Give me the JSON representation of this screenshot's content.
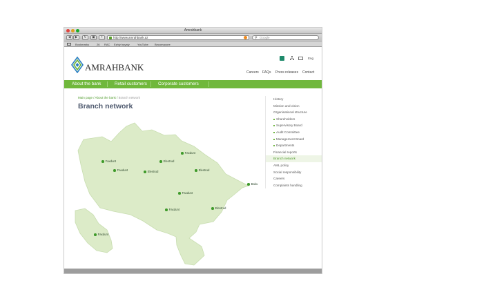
{
  "window": {
    "title": "Amrahbank"
  },
  "toolbar": {
    "url": "http://www.amrahbank.az",
    "search_placeholder": "Google",
    "back_icon": "back-arrow-icon",
    "forward_icon": "forward-arrow-icon",
    "reload_icon": "reload-icon",
    "add_icon": "plus-icon"
  },
  "bookmarks": [
    "Bookmarks",
    "26",
    "RAC",
    "Ezhiy hayaty",
    "YouTube",
    "Becomaoore"
  ],
  "site": {
    "brand": "AMRAHBANK",
    "lang": "Eng",
    "top_links": [
      "Careers",
      "FAQs",
      "Press releases",
      "Contact"
    ],
    "nav": [
      "About the bank",
      "Retail customers",
      "Corporate customers"
    ],
    "breadcrumb": {
      "home": "Main page",
      "parent": "About the bank",
      "current": "Branch network"
    },
    "page_title": "Branch network",
    "map_pins": [
      {
        "label": "Faxdunt"
      },
      {
        "label": "Faxdunt"
      },
      {
        "label": "Elestrud"
      },
      {
        "label": "Faxdunt"
      },
      {
        "label": "Elestrud"
      },
      {
        "label": "Elestrud"
      },
      {
        "label": "Baku"
      },
      {
        "label": "Faxdunt"
      },
      {
        "label": "Faxdunt"
      },
      {
        "label": "Elestrud"
      },
      {
        "label": "Faxdunt"
      }
    ],
    "sidebar": [
      {
        "label": "History",
        "sub": false,
        "active": false
      },
      {
        "label": "Mission and vision",
        "sub": false,
        "active": false
      },
      {
        "label": "Organisational structure",
        "sub": false,
        "active": false
      },
      {
        "label": "Shareholders",
        "sub": true,
        "active": false
      },
      {
        "label": "Supervisory Board",
        "sub": true,
        "active": false
      },
      {
        "label": "Audit Committee",
        "sub": true,
        "active": false
      },
      {
        "label": "Management Board",
        "sub": true,
        "active": false
      },
      {
        "label": "Departments",
        "sub": true,
        "active": false
      },
      {
        "label": "Financial reports",
        "sub": false,
        "active": false
      },
      {
        "label": "Branch network",
        "sub": false,
        "active": true
      },
      {
        "label": "AML policy",
        "sub": false,
        "active": false
      },
      {
        "label": "Social responsibility",
        "sub": false,
        "active": false
      },
      {
        "label": "Careers",
        "sub": false,
        "active": false
      },
      {
        "label": "Complaints handling",
        "sub": false,
        "active": false
      }
    ]
  },
  "colors": {
    "nav_green": "#70b83c",
    "map_fill": "#dcebc8",
    "pin_green": "#3e9a2a",
    "title_blue": "#4f5a6f"
  }
}
